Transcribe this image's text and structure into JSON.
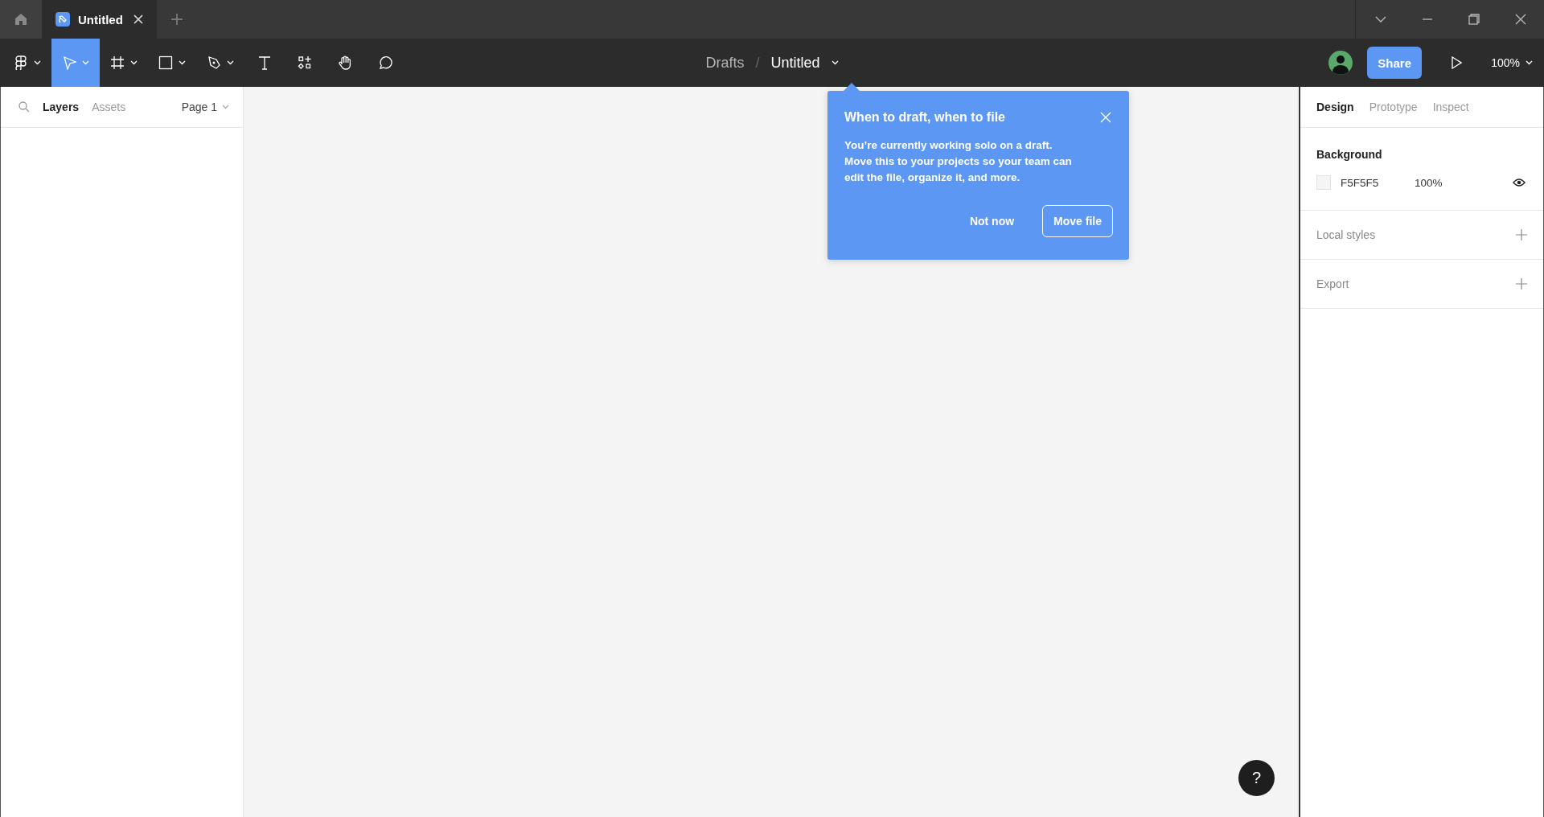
{
  "tab_bar": {
    "tabs": [
      {
        "label": "Untitled",
        "selected": true
      }
    ]
  },
  "toolbar": {
    "tools": [
      {
        "kind": "main-menu",
        "dropdown": true,
        "selected": false
      },
      {
        "kind": "move",
        "dropdown": true,
        "selected": true
      },
      {
        "kind": "frame",
        "dropdown": true,
        "selected": false
      },
      {
        "kind": "shape",
        "dropdown": true,
        "selected": false
      },
      {
        "kind": "pen",
        "dropdown": true,
        "selected": false
      },
      {
        "kind": "text",
        "dropdown": false,
        "selected": false
      },
      {
        "kind": "resources",
        "dropdown": false,
        "selected": false
      },
      {
        "kind": "hand",
        "dropdown": false,
        "selected": false
      },
      {
        "kind": "comment",
        "dropdown": false,
        "selected": false
      }
    ],
    "breadcrumb": {
      "folder": "Drafts",
      "separator": "/",
      "file": "Untitled"
    },
    "share_button": "Share",
    "zoom": "100%"
  },
  "left_panel": {
    "tabs": [
      {
        "label": "Layers",
        "selected": true
      },
      {
        "label": "Assets",
        "selected": false
      }
    ],
    "page": "Page 1"
  },
  "popover": {
    "title": "When to draft, when to file",
    "body": "You’re currently working solo on a draft. Move this to your projects so your team can edit the file, organize it, and more.",
    "buttons": [
      {
        "label": "Not now",
        "kind": "text"
      },
      {
        "label": "Move file",
        "kind": "outline"
      }
    ]
  },
  "right_panel": {
    "tabs": [
      {
        "label": "Design",
        "selected": true
      },
      {
        "label": "Prototype",
        "selected": false
      },
      {
        "label": "Inspect",
        "selected": false
      }
    ],
    "background": {
      "title": "Background",
      "hex": "F5F5F5",
      "opacity": "100%"
    },
    "sections": [
      {
        "title": "Local styles"
      },
      {
        "title": "Export"
      }
    ]
  },
  "help_button": "?"
}
